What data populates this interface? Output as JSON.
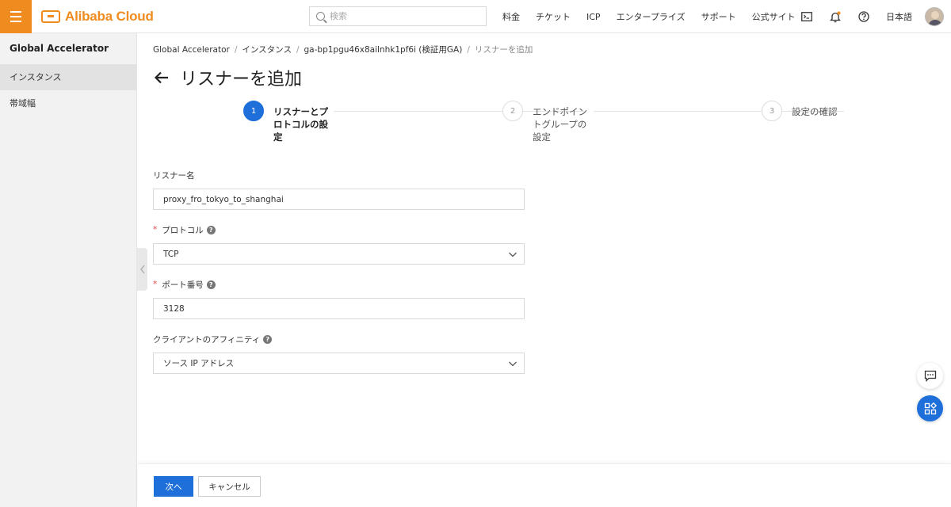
{
  "topbar": {
    "brand": "Alibaba Cloud",
    "search_placeholder": "検索",
    "nav": [
      "料金",
      "チケット",
      "ICP",
      "エンタープライズ",
      "サポート",
      "公式サイト"
    ],
    "language": "日本語"
  },
  "sidebar": {
    "title": "Global Accelerator",
    "items": [
      {
        "label": "インスタンス",
        "active": true
      },
      {
        "label": "帯域幅",
        "active": false
      }
    ]
  },
  "breadcrumb": {
    "items": [
      "Global Accelerator",
      "インスタンス",
      "ga-bp1pgu46x8ailnhk1pf6i (検証用GA)"
    ],
    "current": "リスナーを追加",
    "separator": "/"
  },
  "page": {
    "title": "リスナーを追加"
  },
  "steps": [
    {
      "number": "1",
      "label": "リスナーとプロトコルの設定",
      "active": true
    },
    {
      "number": "2",
      "label": "エンドポイントグループの設定",
      "active": false
    },
    {
      "number": "3",
      "label": "設定の確認",
      "active": false
    }
  ],
  "form": {
    "listener_name": {
      "label": "リスナー名",
      "value": "proxy_fro_tokyo_to_shanghai"
    },
    "protocol": {
      "label": "プロトコル",
      "required_mark": "*",
      "value": "TCP"
    },
    "port": {
      "label": "ポート番号",
      "required_mark": "*",
      "value": "3128"
    },
    "affinity": {
      "label": "クライアントのアフィニティ",
      "value": "ソース IP アドレス"
    }
  },
  "footer": {
    "next_label": "次へ",
    "cancel_label": "キャンセル"
  },
  "colors": {
    "brand": "#f08c1f",
    "primary": "#1e6fd9",
    "required": "#e0454b"
  }
}
